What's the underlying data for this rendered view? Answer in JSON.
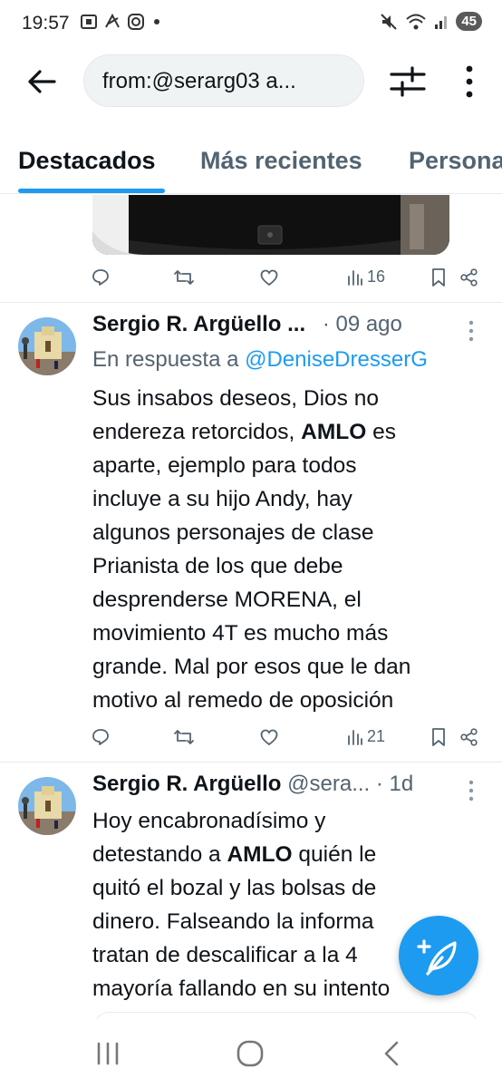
{
  "status_bar": {
    "time": "19:57",
    "battery": "45",
    "left_icons": [
      "screenshot-icon",
      "app-icon",
      "instagram-icon",
      "dot-icon"
    ],
    "right_icons": [
      "mute-icon",
      "wifi-icon",
      "signal-icon"
    ]
  },
  "topbar": {
    "search_value": "from:@serarg03 a..."
  },
  "tabs": [
    {
      "label": "Destacados",
      "active": true
    },
    {
      "label": "Más recientes",
      "active": false
    },
    {
      "label": "Persona",
      "active": false
    }
  ],
  "colors": {
    "accent": "#1d9bf0",
    "text_primary": "#0f1419",
    "text_secondary": "#536471",
    "divider": "#e6ecf0"
  },
  "tweet0": {
    "views": "16"
  },
  "tweet1": {
    "name": "Sergio R. Argüello ...",
    "time": "· 09 ago",
    "reply_prefix": "En respuesta a ",
    "reply_mention": "@DeniseDresserG",
    "body_lines": [
      "Sus insabos deseos, Dios no",
      "endereza retorcidos, ",
      "AMLO",
      " es",
      "aparte, ejemplo para todos",
      "incluye a su hijo Andy, hay",
      "algunos personajes de clase",
      "Prianista de los que debe",
      "desprenderse MORENA, el",
      "movimiento 4T es mucho más",
      "grande. Mal por esos que le dan",
      "motivo al remedo de oposición"
    ],
    "views": "21"
  },
  "tweet2": {
    "name": "Sergio R. Argüello",
    "handle": " @sera...",
    "time": " · 1d",
    "body_lines": [
      "Hoy encabronadísimo y",
      "detestando a ",
      "AMLO",
      " quién le",
      "quitó el bozal y las bolsas de",
      "dinero. Falseando la informa",
      "tratan de descalificar a la 4",
      "mayoría fallando en su intento"
    ]
  }
}
